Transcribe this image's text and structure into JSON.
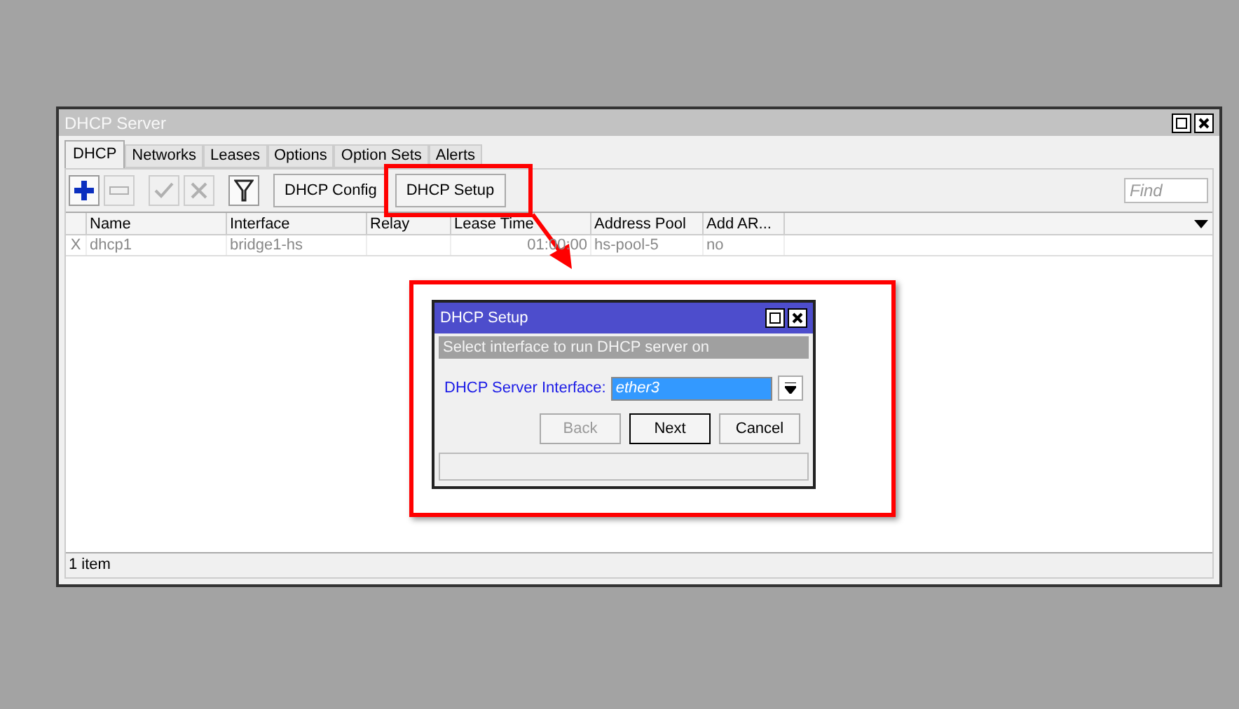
{
  "window": {
    "title": "DHCP Server"
  },
  "tabs": [
    {
      "label": "DHCP",
      "selected": true
    },
    {
      "label": "Networks",
      "selected": false
    },
    {
      "label": "Leases",
      "selected": false
    },
    {
      "label": "Options",
      "selected": false
    },
    {
      "label": "Option Sets",
      "selected": false
    },
    {
      "label": "Alerts",
      "selected": false
    }
  ],
  "toolbar": {
    "buttons": [
      {
        "kind": "add",
        "disabled": false
      },
      {
        "kind": "remove",
        "disabled": true
      },
      {
        "kind": "enable",
        "disabled": true
      },
      {
        "kind": "disable",
        "disabled": true
      },
      {
        "kind": "filter",
        "disabled": false
      }
    ],
    "text_buttons": [
      "DHCP Config",
      "DHCP Setup"
    ],
    "search": {
      "placeholder": "Find"
    }
  },
  "table": {
    "columns": [
      "Name",
      "Interface",
      "Relay",
      "Lease Time",
      "Address Pool",
      "Add AR..."
    ],
    "rows": [
      {
        "disabled": true,
        "flag": "X",
        "cells": [
          "dhcp1",
          "bridge1-hs",
          "",
          "01:00:00",
          "hs-pool-5",
          "no"
        ]
      }
    ]
  },
  "status_bar": "1 item",
  "dialog": {
    "title": "DHCP Setup",
    "subtitle": "Select interface to run DHCP server on",
    "field_label": "DHCP Server Interface:",
    "field_value": "ether3",
    "buttons": [
      {
        "label": "Back",
        "disabled": true,
        "default": false
      },
      {
        "label": "Next",
        "disabled": false,
        "default": true
      },
      {
        "label": "Cancel",
        "disabled": false,
        "default": false
      }
    ]
  }
}
